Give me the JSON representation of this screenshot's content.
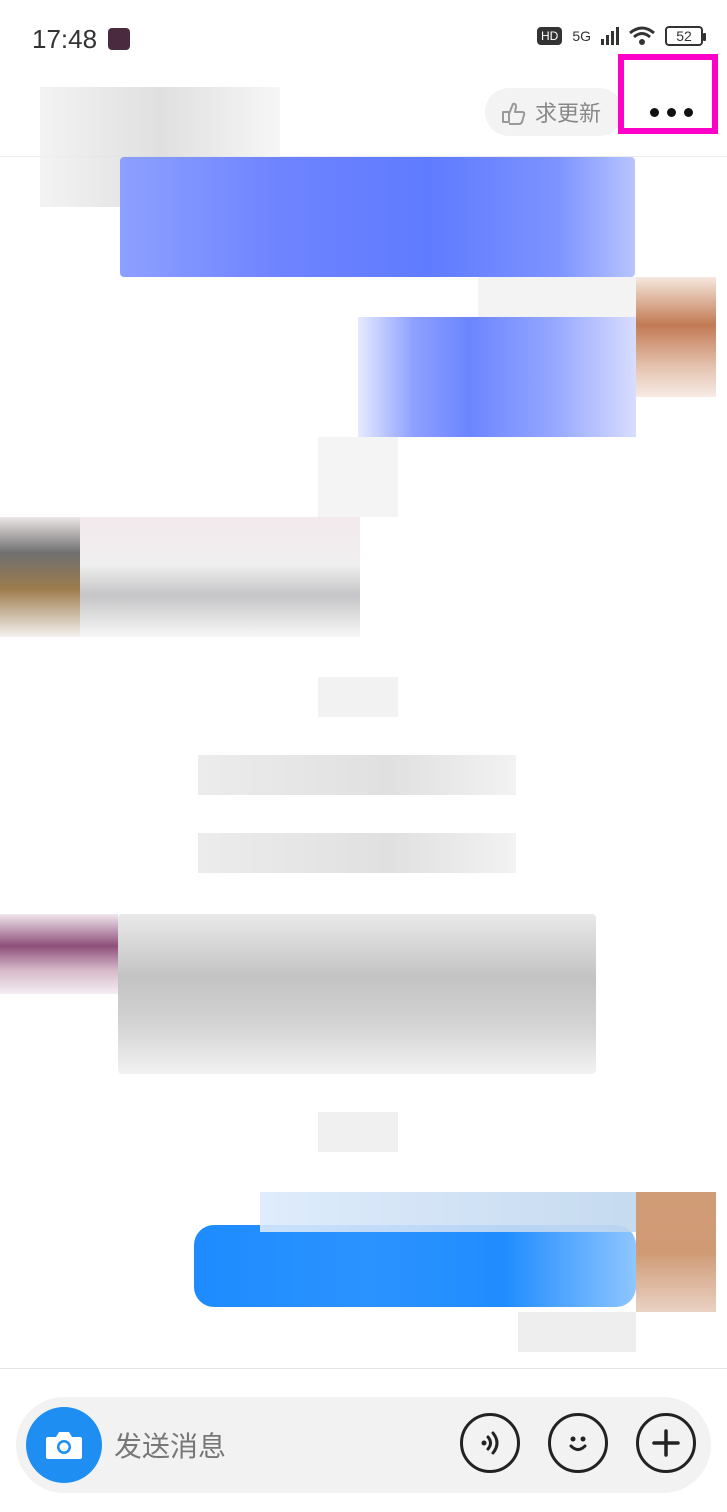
{
  "status_bar": {
    "time": "17:48",
    "hd": "HD",
    "network": "5G",
    "battery": "52"
  },
  "header": {
    "update_label": "求更新"
  },
  "input_bar": {
    "placeholder": "发送消息"
  },
  "colors": {
    "accent_blue": "#1e8ef2",
    "bubble_purple": "#6b85ff",
    "highlight": "#ff00c8"
  },
  "icons": {
    "camera": "camera-icon",
    "voice": "voice-icon",
    "emoji": "emoji-icon",
    "plus": "plus-icon",
    "more": "more-icon",
    "update_hand": "hand-pointing-icon"
  }
}
